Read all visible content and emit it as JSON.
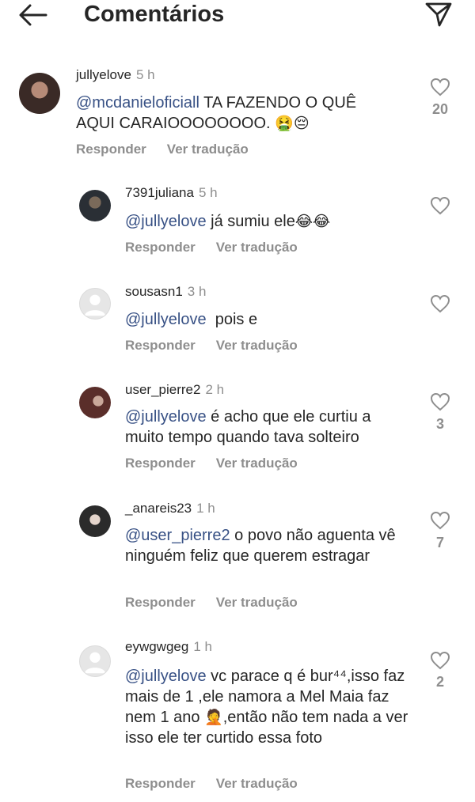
{
  "header": {
    "title": "Comentários",
    "back_icon": "arrow-left-icon",
    "send_icon": "paper-plane-icon"
  },
  "actions": {
    "reply": "Responder",
    "translate": "Ver tradução"
  },
  "comments": [
    {
      "username": "jullyelove",
      "time": "5 h",
      "mention": "@mcdanieloficiall",
      "text": " TA FAZENDO O QUÊ AQUI CARAIOOOOOOOO. ",
      "emoji": "🤮😔",
      "likes": "20"
    },
    {
      "username": "7391juliana",
      "time": "5 h",
      "mention": "@jullyelove",
      "text": " já sumiu ele",
      "emoji": "😂😂",
      "likes": ""
    },
    {
      "username": "sousasn1",
      "time": "3 h",
      "mention": "@jullyelove",
      "text": "  pois e",
      "emoji": "",
      "likes": ""
    },
    {
      "username": "user_pierre2",
      "time": "2 h",
      "mention": "@jullyelove",
      "text": " é acho que ele curtiu a muito tempo quando tava solteiro",
      "emoji": "",
      "likes": "3"
    },
    {
      "username": "_anareis23",
      "time": "1 h",
      "mention": "@user_pierre2",
      "text": " o povo não aguenta vê ninguém feliz que querem estragar",
      "emoji": "",
      "likes": "7"
    },
    {
      "username": "eywgwgeg",
      "time": "1 h",
      "mention": "@jullyelove",
      "text": " vc parace q é bur⁴⁴,isso faz mais de 1 ,ele namora a Mel Maia faz nem 1 ano ",
      "emoji": "🤦",
      "text2": ",então não tem nada a ver isso ele ter curtido essa foto",
      "likes": "2"
    }
  ]
}
